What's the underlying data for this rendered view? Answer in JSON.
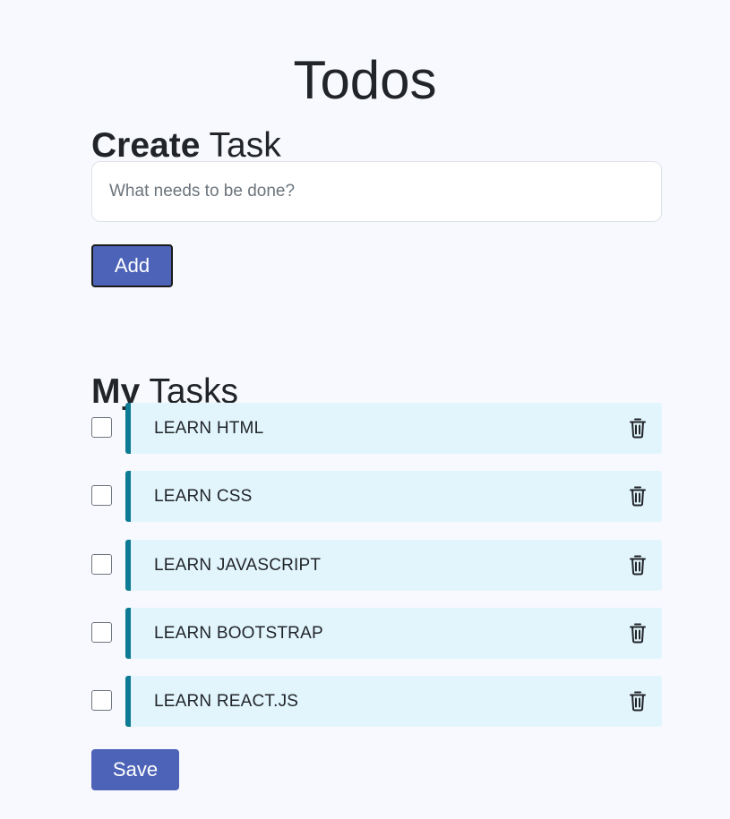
{
  "app": {
    "title": "Todos"
  },
  "create_section": {
    "heading_bold": "Create",
    "heading_rest": "Task",
    "input_placeholder": "What needs to be done?",
    "input_value": "",
    "add_label": "Add"
  },
  "tasks_section": {
    "heading_bold": "My",
    "heading_rest": "Tasks",
    "tasks": [
      {
        "label": "LEARN HTML",
        "checked": false
      },
      {
        "label": "LEARN CSS",
        "checked": false
      },
      {
        "label": "LEARN JAVASCRIPT",
        "checked": false
      },
      {
        "label": "LEARN BOOTSTRAP",
        "checked": false
      },
      {
        "label": "LEARN REACT.JS",
        "checked": false
      }
    ],
    "delete_icon": "trash-icon",
    "save_label": "Save"
  },
  "colors": {
    "background": "#f8f9fe",
    "primary_button": "#4d63b8",
    "task_card": "#e2f5fd",
    "task_accent": "#0c7b93"
  }
}
